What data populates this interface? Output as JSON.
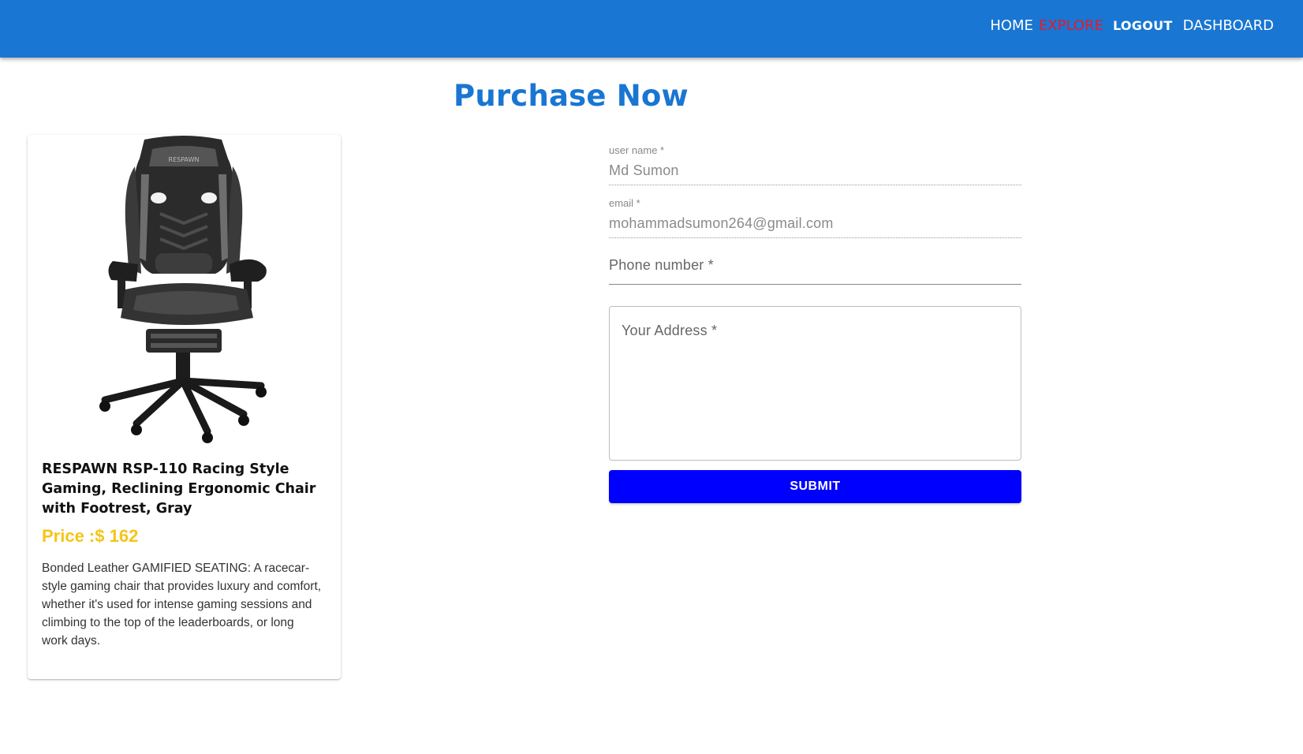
{
  "nav": {
    "home": "HOME",
    "explore": "EXPLORE",
    "logout": "LOGOUT",
    "dashboard": "DASHBOARD"
  },
  "page": {
    "title": "Purchase Now"
  },
  "product": {
    "image_icon": "gaming-chair-image",
    "name": "RESPAWN RSP-110 Racing Style Gaming, Reclining Ergonomic Chair with Footrest, Gray",
    "price": "Price :$ 162",
    "description": "Bonded Leather GAMIFIED SEATING: A racecar-style gaming chair that provides luxury and comfort, whether it's used for intense gaming sessions and climbing to the top of the leaderboards, or long work days.",
    "image_brand": "RESPAWN"
  },
  "form": {
    "username_label": "user name *",
    "username_value": "Md Sumon",
    "email_label": "email *",
    "email_value": "mohammadsumon264@gmail.com",
    "phone_placeholder": "Phone number *",
    "address_placeholder": "Your Address *",
    "submit_label": "SUBMIT"
  },
  "colors": {
    "appbar": "#1976d2",
    "explore": "#e31b2f",
    "title": "#1976d2",
    "price": "#f5c518",
    "submit": "#0000ff"
  }
}
